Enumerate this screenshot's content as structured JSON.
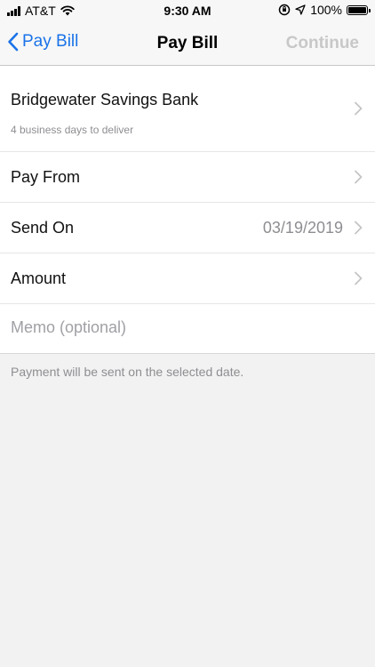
{
  "status": {
    "carrier": "AT&T",
    "time": "9:30 AM",
    "battery": "100%",
    "battery_level": 1.0
  },
  "nav": {
    "back_label": "Pay Bill",
    "title": "Pay Bill",
    "continue_label": "Continue"
  },
  "biller": {
    "name": "Bridgewater Savings Bank",
    "delivery": "4 business days to deliver"
  },
  "rows": {
    "pay_from": {
      "label": "Pay From"
    },
    "send_on": {
      "label": "Send On",
      "value": "03/19/2019"
    },
    "amount": {
      "label": "Amount"
    }
  },
  "memo": {
    "placeholder": "Memo (optional)"
  },
  "footnote": "Payment will be sent on the selected date.",
  "colors": {
    "accent": "#1a73e8",
    "disabled": "#c8c8c8"
  },
  "icons": {
    "back": "chevron-left-icon",
    "row": "chevron-right-icon"
  }
}
